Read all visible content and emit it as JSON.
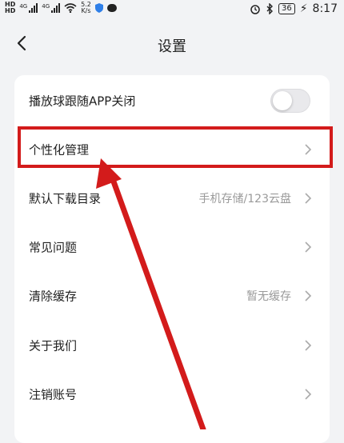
{
  "status_bar": {
    "hd_top": "HD",
    "hd_bottom": "HD",
    "network_1": "4G",
    "network_2": "4G",
    "speed_value": "5.2",
    "speed_unit": "K/s",
    "battery": "36",
    "time": "8:17"
  },
  "header": {
    "title": "设置"
  },
  "settings": {
    "items": [
      {
        "label": "播放球跟随APP关闭",
        "type": "toggle",
        "enabled": false
      },
      {
        "label": "个性化管理",
        "value": ""
      },
      {
        "label": "默认下载目录",
        "value": "手机存储/123云盘"
      },
      {
        "label": "常见问题",
        "value": ""
      },
      {
        "label": "清除缓存",
        "value": "暂无缓存"
      },
      {
        "label": "关于我们",
        "value": ""
      },
      {
        "label": "注销账号",
        "value": ""
      }
    ]
  },
  "colors": {
    "annotation_red": "#d31b1b",
    "background": "#f2f3f5",
    "card": "#ffffff",
    "secondary_text": "#9a9a9a"
  }
}
